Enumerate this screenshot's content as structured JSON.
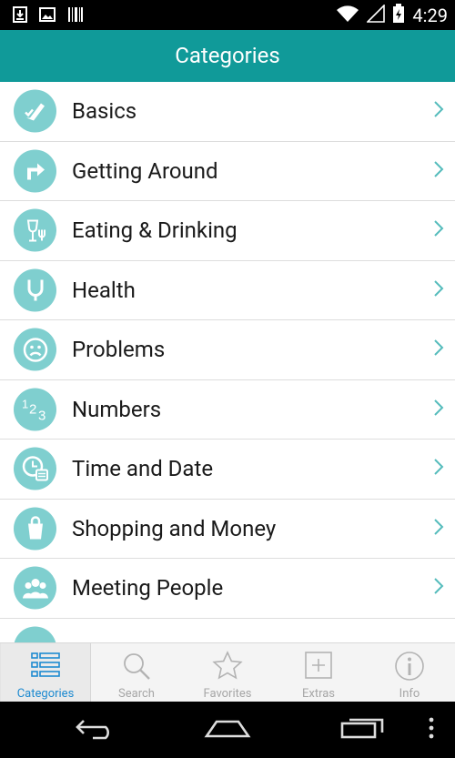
{
  "status_bar": {
    "time": "4:29",
    "icons": [
      "download-icon",
      "image-icon",
      "barcode-icon",
      "wifi-icon",
      "signal-icon",
      "battery-charging-icon"
    ]
  },
  "app_bar": {
    "title": "Categories"
  },
  "categories": [
    {
      "label": "Basics",
      "icon": "pencil-check-icon"
    },
    {
      "label": "Getting Around",
      "icon": "turn-arrow-icon"
    },
    {
      "label": "Eating & Drinking",
      "icon": "glass-fork-icon"
    },
    {
      "label": "Health",
      "icon": "stethoscope-icon"
    },
    {
      "label": "Problems",
      "icon": "sad-face-icon"
    },
    {
      "label": "Numbers",
      "icon": "numbers-123-icon"
    },
    {
      "label": "Time and Date",
      "icon": "clock-calendar-icon"
    },
    {
      "label": "Shopping and Money",
      "icon": "shopping-bag-icon"
    },
    {
      "label": "Meeting People",
      "icon": "people-icon"
    }
  ],
  "tabs": [
    {
      "label": "Categories",
      "icon": "list-icon",
      "active": true
    },
    {
      "label": "Search",
      "icon": "search-icon",
      "active": false
    },
    {
      "label": "Favorites",
      "icon": "star-icon",
      "active": false
    },
    {
      "label": "Extras",
      "icon": "plus-box-icon",
      "active": false
    },
    {
      "label": "Info",
      "icon": "info-icon",
      "active": false
    }
  ],
  "colors": {
    "header": "#109a99",
    "icon_circle": "#7fcfcf",
    "chevron": "#55bcbc",
    "active_tab_label": "#1d8ad0"
  }
}
